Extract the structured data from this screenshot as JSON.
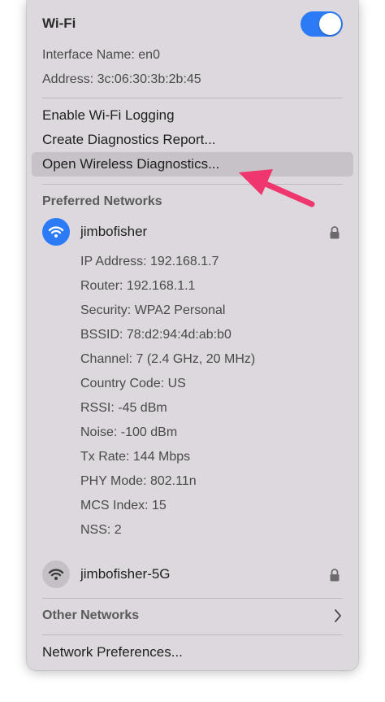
{
  "header": {
    "title": "Wi-Fi",
    "toggle_on": true,
    "interface_line": "Interface Name: en0",
    "address_line": "Address: 3c:06:30:3b:2b:45"
  },
  "menu": {
    "enable_logging": "Enable Wi-Fi Logging",
    "create_report": "Create Diagnostics Report...",
    "open_diagnostics": "Open Wireless Diagnostics..."
  },
  "preferred": {
    "label": "Preferred Networks",
    "networks": [
      {
        "name": "jimbofisher",
        "connected": true,
        "locked": true,
        "details": [
          "IP Address: 192.168.1.7",
          "Router: 192.168.1.1",
          "Security: WPA2 Personal",
          "BSSID: 78:d2:94:4d:ab:b0",
          "Channel: 7 (2.4 GHz, 20 MHz)",
          "Country Code: US",
          "RSSI: -45 dBm",
          "Noise: -100 dBm",
          "Tx Rate: 144 Mbps",
          "PHY Mode: 802.11n",
          "MCS Index: 15",
          "NSS: 2"
        ]
      },
      {
        "name": "jimbofisher-5G",
        "connected": false,
        "locked": true
      }
    ]
  },
  "other_networks": {
    "label": "Other Networks"
  },
  "network_preferences": {
    "label": "Network Preferences..."
  },
  "colors": {
    "accent": "#2a7bf5",
    "menu_bg": "#dcd8dd",
    "highlight": "#c6c2c7",
    "annotation_arrow": "#f0366e"
  },
  "icons": {
    "wifi": "wifi-icon",
    "lock": "lock-icon",
    "chevron": "chevron-right-icon",
    "arrow": "annotation-arrow-icon"
  }
}
